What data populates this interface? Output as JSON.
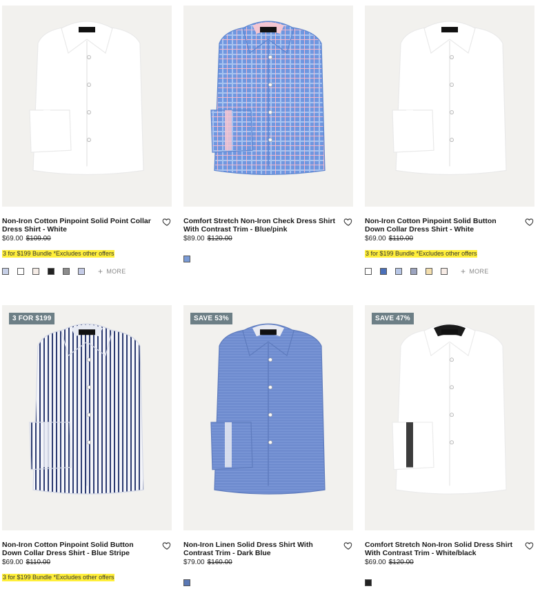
{
  "products": [
    {
      "title": "Non-Iron Cotton Pinpoint Solid Point Collar Dress Shirt - White",
      "price": "$69.00",
      "was_price": "$109.00",
      "promo": "3 for $199 Bundle *Excludes other offers",
      "badge": "",
      "swatch_colors": [
        "#c6cfe6",
        "#ffffff",
        "#f5ece6",
        "#222222",
        "#8c8c8c",
        "#c4cbe6"
      ],
      "more_label": "MORE",
      "shirt": {
        "body": "#ffffff",
        "shade": "#e9e9e9",
        "trim": "#ffffff",
        "style": "solid"
      }
    },
    {
      "title": "Comfort Stretch Non-Iron Check Dress Shirt With Contrast Trim - Blue/pink",
      "price": "$89.00",
      "was_price": "$120.00",
      "promo": "",
      "badge": "",
      "swatch_colors": [
        "#7a9bd6"
      ],
      "more_label": "",
      "shirt": {
        "body": "#6f97e0",
        "shade": "#5b84cf",
        "trim": "#f3c6d2",
        "style": "check"
      }
    },
    {
      "title": "Non-Iron Cotton Pinpoint Solid Button Down Collar Dress Shirt - White",
      "price": "$69.00",
      "was_price": "$110.00",
      "promo": "3 for $199 Bundle *Excludes other offers",
      "badge": "",
      "swatch_colors": [
        "#ffffff",
        "#4a6fb8",
        "#b7c6e6",
        "#9ca4bf",
        "#f4dfae",
        "#f7ece6"
      ],
      "more_label": "MORE",
      "shirt": {
        "body": "#ffffff",
        "shade": "#e9e9e9",
        "trim": "#ffffff",
        "style": "solid"
      }
    },
    {
      "title": "Non-Iron Cotton Pinpoint Solid Button Down Collar Dress Shirt - Blue Stripe",
      "price": "$69.00",
      "was_price": "$110.00",
      "promo": "3 for $199 Bundle *Excludes other offers",
      "badge": "3 FOR $199",
      "swatch_colors": [],
      "more_label": "",
      "shirt": {
        "body": "#e7eaf3",
        "shade": "#d4d8e6",
        "trim": "#e7eaf3",
        "style": "stripe"
      }
    },
    {
      "title": "Non-Iron Linen Solid Dress Shirt With Contrast Trim - Dark Blue",
      "price": "$79.00",
      "was_price": "$160.00",
      "promo": "",
      "badge": "SAVE 53%",
      "swatch_colors": [
        "#5a78b5"
      ],
      "more_label": "",
      "shirt": {
        "body": "#6f8ccf",
        "shade": "#5e7bbd",
        "trim": "#e8eaf2",
        "style": "linen"
      }
    },
    {
      "title": "Comfort Stretch Non-Iron Solid Dress Shirt With Contrast Trim - White/black",
      "price": "$69.00",
      "was_price": "$120.00",
      "promo": "",
      "badge": "SAVE 47%",
      "swatch_colors": [
        "#222222"
      ],
      "more_label": "",
      "shirt": {
        "body": "#ffffff",
        "shade": "#ebebeb",
        "trim": "#1a1a1a",
        "style": "solid"
      }
    }
  ]
}
